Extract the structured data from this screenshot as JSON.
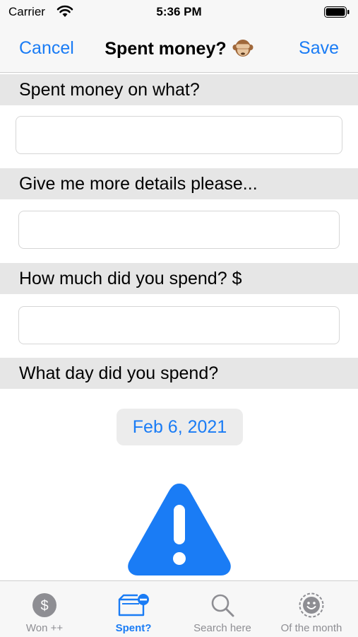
{
  "status_bar": {
    "carrier": "Carrier",
    "time": "5:36 PM"
  },
  "nav": {
    "cancel_label": "Cancel",
    "title": "Spent money?",
    "title_emoji": "see-no-evil-monkey-icon",
    "save_label": "Save"
  },
  "form": {
    "what": {
      "header": "Spent money on what?",
      "value": "",
      "placeholder": ""
    },
    "details": {
      "header": "Give me more details please...",
      "value": "",
      "placeholder": ""
    },
    "amount": {
      "header": "How much did you spend? $",
      "value": "",
      "placeholder": ""
    },
    "date": {
      "header": "What day did you spend?",
      "value": "Feb 6, 2021"
    }
  },
  "tabs": [
    {
      "label": "Won ++",
      "icon": "dollar-circle-icon",
      "active": false
    },
    {
      "label": "Spent?",
      "icon": "wallet-minus-icon",
      "active": true
    },
    {
      "label": "Search here",
      "icon": "search-icon",
      "active": false
    },
    {
      "label": "Of the month",
      "icon": "smiley-badge-icon",
      "active": false
    }
  ],
  "colors": {
    "accent": "#1a7cf5",
    "tab_inactive": "#8e8e93",
    "section_bg": "#e6e6e6",
    "bar_bg": "#f7f7f7"
  }
}
